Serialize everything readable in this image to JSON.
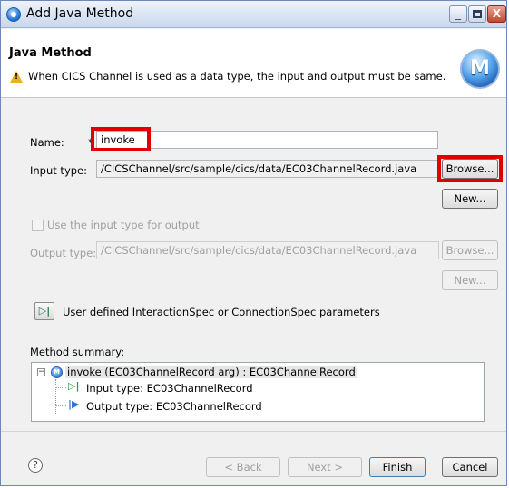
{
  "window": {
    "title": "Add Java Method",
    "minimize": "_",
    "close": "X"
  },
  "header": {
    "title": "Java Method",
    "message": "When CICS Channel is used as a data type, the input and output must be same.",
    "logo_letter": "M"
  },
  "form": {
    "name_label": "Name:",
    "required_marker": "*",
    "name_value": "invoke",
    "input_type_label": "Input type:",
    "input_type_value": "/CICSChannel/src/sample/cics/data/EC03ChannelRecord.java",
    "browse_label": "Browse...",
    "new_label": "New...",
    "use_input_label": "Use the input type for output",
    "output_type_label": "Output type:",
    "output_type_value": "/CICSChannel/src/sample/cics/data/EC03ChannelRecord.java",
    "output_browse_label": "Browse...",
    "output_new_label": "New...",
    "spec_label": "User defined InteractionSpec or ConnectionSpec parameters"
  },
  "summary": {
    "label": "Method summary:",
    "root": "invoke (EC03ChannelRecord arg) : EC03ChannelRecord",
    "input": "Input type: EC03ChannelRecord",
    "output": "Output type: EC03ChannelRecord"
  },
  "footer": {
    "help": "?",
    "back": "< Back",
    "next": "Next >",
    "finish": "Finish",
    "cancel": "Cancel"
  },
  "colors": {
    "highlight": "#e00000",
    "warning": "#e8b21e"
  },
  "icons": {
    "app": "eclipse-icon",
    "warning": "warning-icon",
    "logo": "method-wizard-logo",
    "help": "help-icon"
  }
}
